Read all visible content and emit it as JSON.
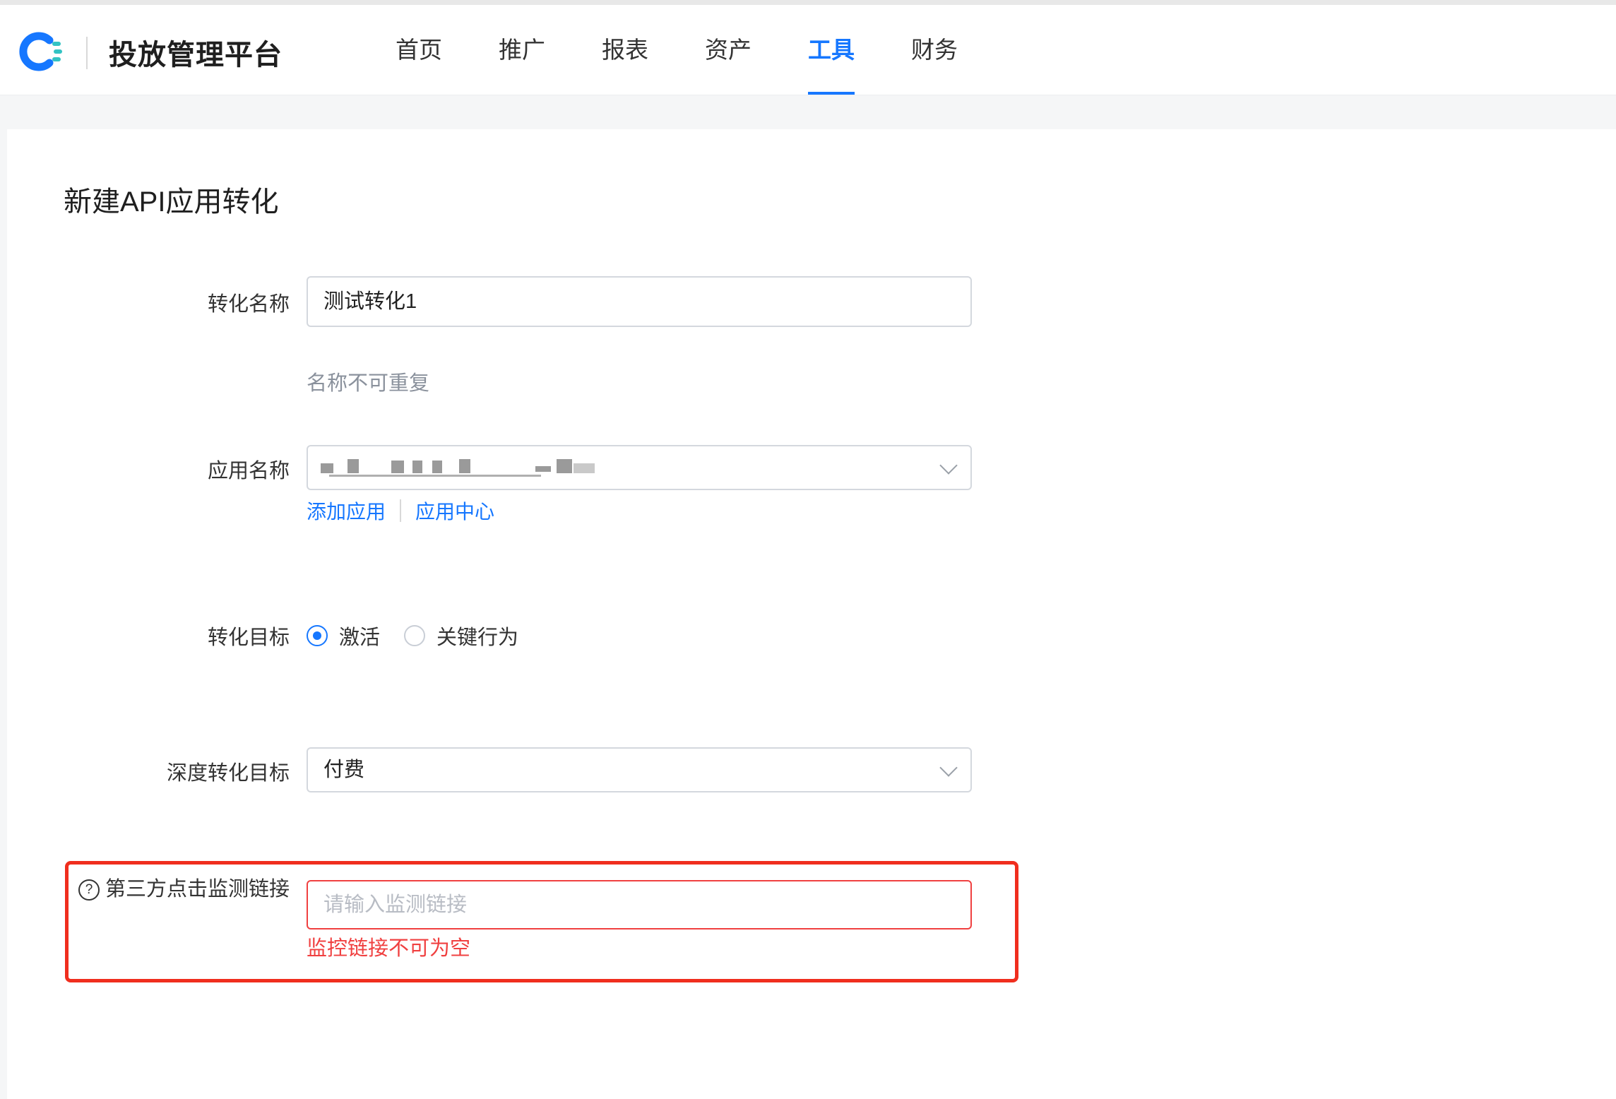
{
  "header": {
    "brand": "投放管理平台",
    "logo_icon": "brand-logo-icon",
    "nav": [
      {
        "label": "首页",
        "active": false
      },
      {
        "label": "推广",
        "active": false
      },
      {
        "label": "报表",
        "active": false
      },
      {
        "label": "资产",
        "active": false
      },
      {
        "label": "工具",
        "active": true
      },
      {
        "label": "财务",
        "active": false
      }
    ],
    "accent_color": "#1677ff"
  },
  "form": {
    "title": "新建API应用转化",
    "conversion_name": {
      "label": "转化名称",
      "value": "测试转化1",
      "help": "名称不可重复"
    },
    "app_name": {
      "label": "应用名称",
      "value_masked": true,
      "links": {
        "add_app": "添加应用",
        "app_center": "应用中心"
      }
    },
    "conversion_goal": {
      "label": "转化目标",
      "options": [
        {
          "label": "激活",
          "checked": true
        },
        {
          "label": "关键行为",
          "checked": false
        }
      ]
    },
    "deep_conversion_goal": {
      "label": "深度转化目标",
      "value": "付费"
    },
    "third_party_click_url": {
      "label": "第三方点击监测链接",
      "help_icon": "question-circle-icon",
      "placeholder": "请输入监测链接",
      "error": "监控链接不可为空",
      "error_color": "#f04040",
      "highlight_color": "#f02e1e"
    }
  }
}
